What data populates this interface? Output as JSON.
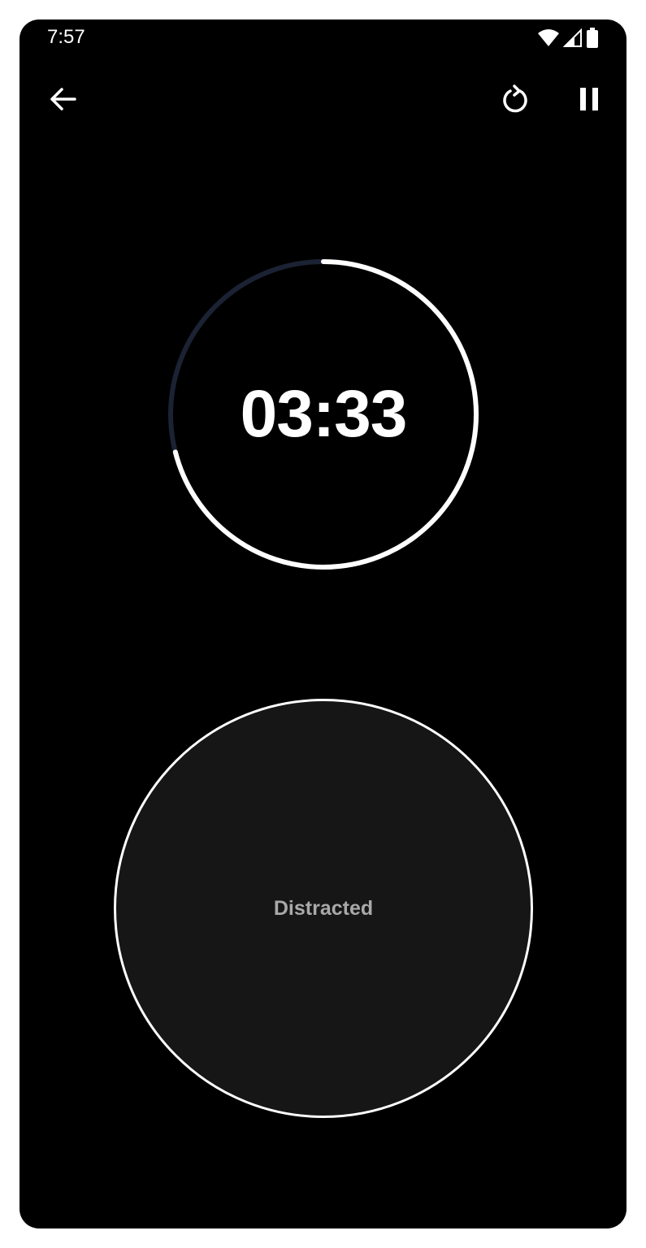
{
  "status_bar": {
    "time": "7:57",
    "icons": [
      "wifi-icon",
      "cell-signal-icon",
      "battery-icon"
    ]
  },
  "toolbar": {
    "back_icon": "arrow-left-icon",
    "reset_icon": "restart-icon",
    "pause_icon": "pause-icon"
  },
  "timer": {
    "display": "03:33",
    "progress_remaining": 0.71,
    "colors": {
      "progress": "#ffffff",
      "track": "#1b2233"
    }
  },
  "distract_button": {
    "label": "Distracted"
  },
  "colors": {
    "background": "#000000",
    "button_fill": "#161616",
    "label_text": "#a9a9a9"
  }
}
